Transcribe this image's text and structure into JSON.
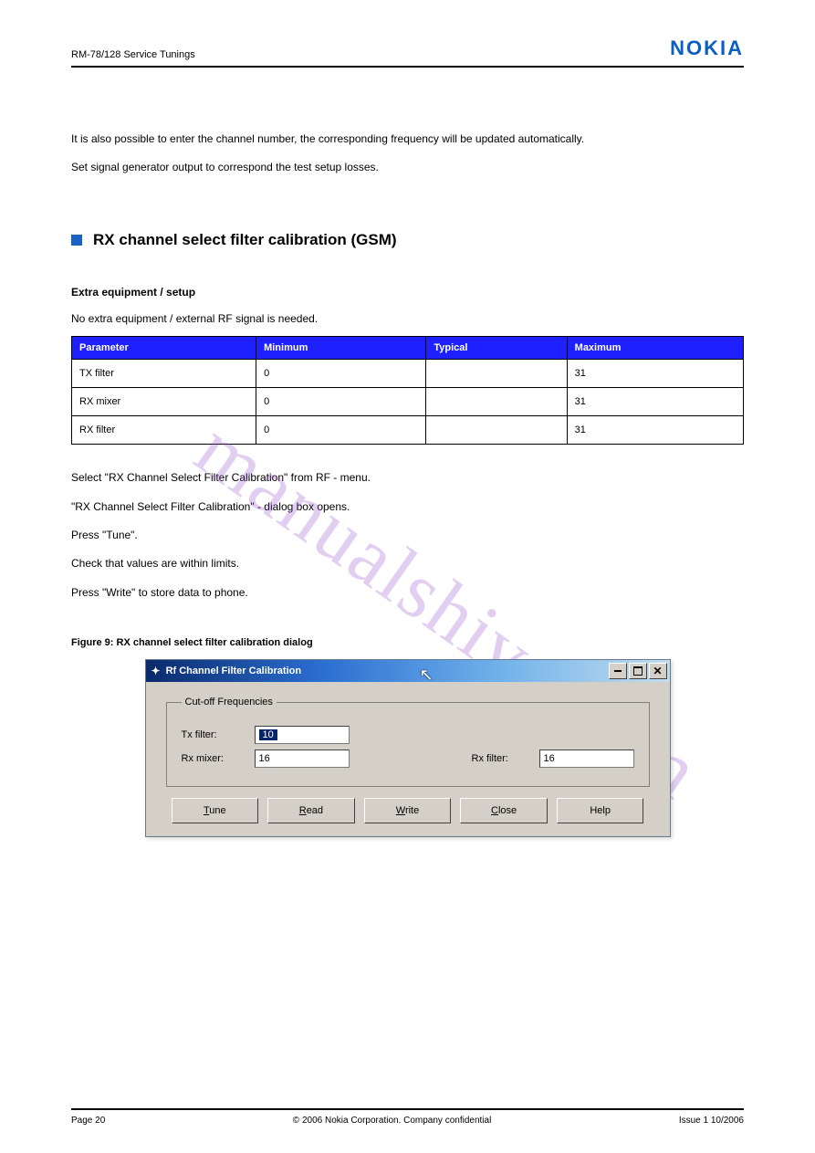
{
  "header": {
    "doc_left": "RM-78/128 Service Tunings",
    "logo": "NOKIA"
  },
  "intro": {
    "p1": "It is also possible to enter the channel number, the corresponding frequency will be updated automatically.",
    "p2": "Set signal generator output to correspond the test setup losses."
  },
  "section": {
    "title": "RX channel select filter calibration (GSM)"
  },
  "subsection_title": "Extra equipment / setup",
  "subsection_text": "No extra equipment / external RF signal is needed.",
  "table": {
    "headers": [
      "Parameter",
      "Minimum",
      "Typical",
      "Maximum"
    ],
    "rows": [
      [
        "TX filter",
        "0",
        "",
        "31"
      ],
      [
        "RX mixer",
        "0",
        "",
        "31"
      ],
      [
        "RX filter",
        "0",
        "",
        "31"
      ]
    ]
  },
  "steps": {
    "s1": "Select \"RX Channel Select Filter Calibration\" from RF - menu.",
    "s2": "\"RX Channel Select Filter Calibration\" - dialog box opens.",
    "s3": "Press \"Tune\".",
    "s4": "Check that values are within limits.",
    "s5": "Press \"Write\" to store data to phone."
  },
  "figure": {
    "caption": "Figure 9: RX channel select filter calibration dialog"
  },
  "dialog": {
    "title": "Rf Channel Filter Calibration",
    "group_legend": "Cut-off Frequencies",
    "tx_label": "Tx filter:",
    "tx_value": "10",
    "rx_mixer_label": "Rx mixer:",
    "rx_mixer_value": "16",
    "rx_filter_label": "Rx filter:",
    "rx_filter_value": "16",
    "buttons": {
      "tune_u": "T",
      "tune_rest": "une",
      "read_u": "R",
      "read_rest": "ead",
      "write_u": "W",
      "write_rest": "rite",
      "close_u": "C",
      "close_rest": "lose",
      "help": "Help"
    }
  },
  "footer": {
    "left": "Page 20",
    "center": "© 2006 Nokia Corporation. Company confidential",
    "right": "Issue 1   10/2006"
  },
  "watermark": "manualshive.com"
}
